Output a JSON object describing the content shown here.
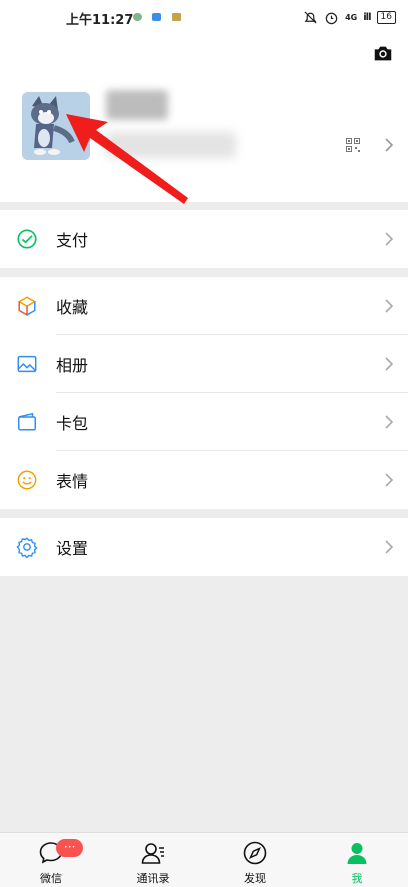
{
  "status_bar": {
    "time": "上午11:27",
    "network": "4G",
    "signal_caption": "ill",
    "battery": "16"
  },
  "profile": {
    "nickname": "昵称",
    "wechat_id": "微信号"
  },
  "menu": {
    "pay": {
      "label": "支付",
      "icon": "pay-icon"
    },
    "favorites": {
      "label": "收藏",
      "icon": "favorites-cube-icon"
    },
    "album": {
      "label": "相册",
      "icon": "album-image-icon"
    },
    "cards": {
      "label": "卡包",
      "icon": "card-wallet-icon"
    },
    "stickers": {
      "label": "表情",
      "icon": "smiley-icon"
    },
    "settings": {
      "label": "设置",
      "icon": "gear-icon"
    }
  },
  "tabbar": {
    "chats": {
      "label": "微信",
      "badge": "···"
    },
    "contacts": {
      "label": "通讯录"
    },
    "discover": {
      "label": "发现"
    },
    "me": {
      "label": "我"
    }
  },
  "colors": {
    "accent": "#07c160",
    "badge": "#fa5151",
    "arrow": "#f01d1d",
    "background": "#ededed"
  }
}
